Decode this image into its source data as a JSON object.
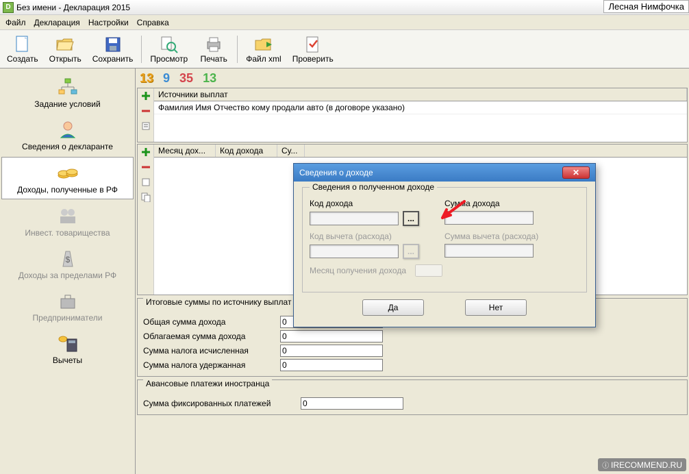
{
  "window": {
    "title": "Без имени - Декларация 2015"
  },
  "watermark_top": "Лесная Нимфочка",
  "watermark_bottom": "IRECOMMEND.RU",
  "menu": {
    "file": "Файл",
    "decl": "Декларация",
    "settings": "Настройки",
    "help": "Справка"
  },
  "toolbar": {
    "create": "Создать",
    "open": "Открыть",
    "save": "Сохранить",
    "preview": "Просмотр",
    "print": "Печать",
    "filexml": "Файл xml",
    "check": "Проверить"
  },
  "rates": {
    "r1": "13",
    "r2": "9",
    "r3": "35",
    "r4": "13"
  },
  "nav": {
    "conditions": "Задание условий",
    "declarant": "Сведения о декларанте",
    "income_rf": "Доходы, полученные в РФ",
    "invest": "Инвест. товарищества",
    "foreign": "Доходы за пределами РФ",
    "entrepreneur": "Предприниматели",
    "deductions": "Вычеты"
  },
  "sources": {
    "header": "Источники выплат",
    "row1": "Фамилия Имя Отчество кому продали авто (в договоре указано)"
  },
  "income_table": {
    "col_month": "Месяц дох...",
    "col_code": "Код дохода",
    "col_sum": "Су..."
  },
  "totals": {
    "title": "Итоговые суммы по источнику выплат",
    "total_income": "Общая сумма дохода",
    "taxable_income": "Облагаемая сумма дохода",
    "tax_calculated": "Сумма налога исчисленная",
    "tax_withheld": "Сумма налога удержанная",
    "val": "0"
  },
  "advance": {
    "title": "Авансовые платежи иностранца",
    "fixed_sum": "Сумма фиксированных платежей",
    "val": "0"
  },
  "dialog": {
    "title": "Сведения о доходе",
    "group_title": "Сведения о полученном доходе",
    "code": "Код дохода",
    "sum": "Сумма дохода",
    "deduct_code": "Код вычета (расхода)",
    "deduct_sum": "Сумма вычета (расхода)",
    "month": "Месяц получения дохода",
    "yes": "Да",
    "no": "Нет",
    "dots": "..."
  }
}
